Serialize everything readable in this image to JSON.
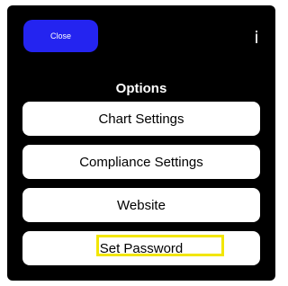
{
  "header": {
    "close_label": "Close",
    "info_icon": "info-icon",
    "info_glyph": "i"
  },
  "options": {
    "title": "Options",
    "items": [
      {
        "label": "Chart Settings"
      },
      {
        "label": "Compliance Settings"
      },
      {
        "label": "Website"
      },
      {
        "label": "Set Password",
        "highlighted": true
      }
    ]
  },
  "colors": {
    "background": "#000000",
    "close_button": "#2424f0",
    "option_button": "#ffffff",
    "highlight": "#f2e600"
  }
}
